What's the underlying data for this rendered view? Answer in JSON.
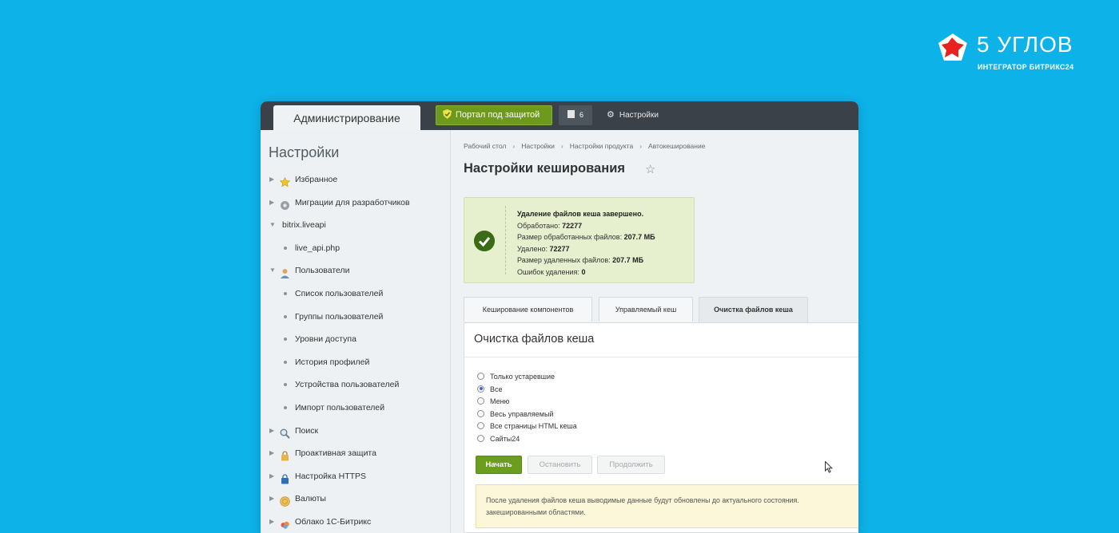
{
  "logo": {
    "title": "5 УГЛОВ",
    "subtitle": "ИНТЕГРАТОР БИТРИКС24",
    "mark_color": "#e8231f"
  },
  "topbar": {
    "admin_tab": "Администрирование",
    "portal_button": "Портал под защитой",
    "counter": "6",
    "settings": "Настройки"
  },
  "sidebar": {
    "title": "Настройки",
    "items": [
      {
        "label": "Избранное",
        "icon": "star-icon",
        "kind": "folder"
      },
      {
        "label": "Миграции для разработчиков",
        "icon": "gear-icon",
        "kind": "folder"
      },
      {
        "label": "bitrix.liveapi",
        "icon": "",
        "kind": "open"
      },
      {
        "label": "live_api.php",
        "icon": "",
        "kind": "child"
      },
      {
        "label": "Пользователи",
        "icon": "user-icon",
        "kind": "open"
      },
      {
        "label": "Список пользователей",
        "icon": "",
        "kind": "child"
      },
      {
        "label": "Группы пользователей",
        "icon": "",
        "kind": "child"
      },
      {
        "label": "Уровни доступа",
        "icon": "",
        "kind": "child"
      },
      {
        "label": "История профилей",
        "icon": "",
        "kind": "child"
      },
      {
        "label": "Устройства пользователей",
        "icon": "",
        "kind": "child"
      },
      {
        "label": "Импорт пользователей",
        "icon": "",
        "kind": "child"
      },
      {
        "label": "Поиск",
        "icon": "search-icon",
        "kind": "folder"
      },
      {
        "label": "Проактивная защита",
        "icon": "lock-icon",
        "kind": "folder"
      },
      {
        "label": "Настройка HTTPS",
        "icon": "padlock-icon",
        "kind": "folder"
      },
      {
        "label": "Валюты",
        "icon": "currency-icon",
        "kind": "folder"
      },
      {
        "label": "Облако 1С-Битрикс",
        "icon": "cloud-icon",
        "kind": "folder"
      }
    ]
  },
  "breadcrumbs": [
    "Рабочий стол",
    "Настройки",
    "Настройки продукта",
    "Автокеширование"
  ],
  "page_title": "Настройки кеширования",
  "success": {
    "heading": "Удаление файлов кеша завершено.",
    "lines": [
      {
        "label": "Обработано:",
        "value": "72277"
      },
      {
        "label": "Размер обработанных файлов:",
        "value": "207.7 МБ"
      },
      {
        "label": "Удалено:",
        "value": "72277"
      },
      {
        "label": "Размер удаленных файлов:",
        "value": "207.7 МБ"
      },
      {
        "label": "Ошибок удаления:",
        "value": "0"
      }
    ]
  },
  "tabs": [
    "Кеширование компонентов",
    "Управляемый кеш",
    "Очистка файлов кеша"
  ],
  "active_tab": "Очистка файлов кеша",
  "panel": {
    "title": "Очистка файлов кеша",
    "options": [
      "Только устаревшие",
      "Все",
      "Меню",
      "Весь управляемый",
      "Все страницы HTML кеша",
      "Сайты24"
    ],
    "selected": "Все",
    "buttons": {
      "start": "Начать",
      "stop": "Остановить",
      "continue": "Продолжить"
    },
    "note_line1": "После удаления файлов кеша выводимые данные будут обновлены до актуального состояния.",
    "note_line2": "закешированными областями."
  },
  "colors": {
    "background": "#0db2e8",
    "topbar": "#3a4148",
    "accent_green": "#6b9e1d",
    "success_bg": "#e6efce",
    "note_bg": "#fbf7d8"
  }
}
